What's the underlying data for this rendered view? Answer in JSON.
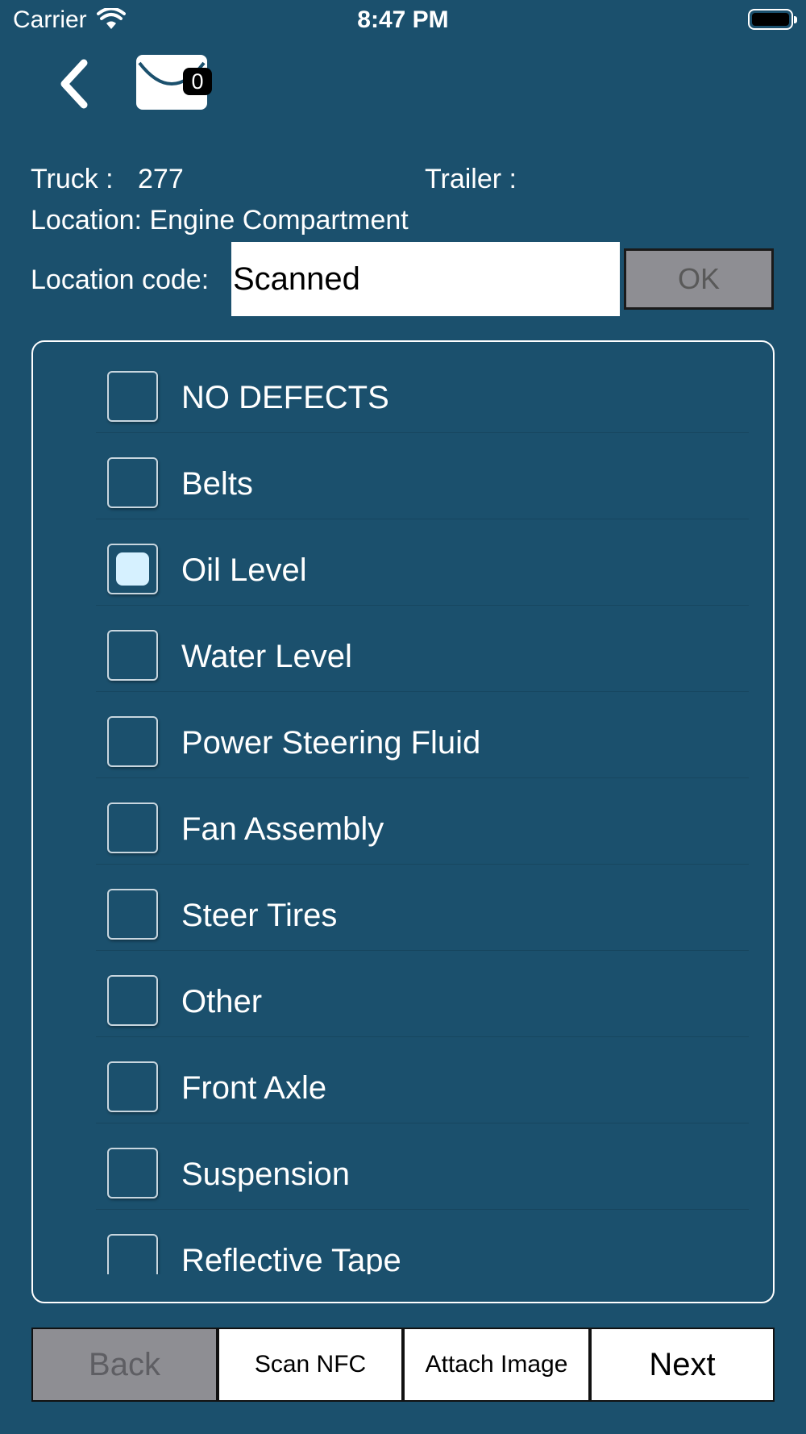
{
  "status_bar": {
    "carrier": "Carrier",
    "time": "8:47 PM"
  },
  "nav": {
    "back_icon": "chevron-left-icon",
    "mail_icon": "envelope-icon",
    "mail_badge": "0"
  },
  "info": {
    "truck_label": "Truck :",
    "truck_value": "277",
    "trailer_label": "Trailer :",
    "location_text": "Location: Engine Compartment",
    "location_code_label": "Location code:",
    "location_code_value": "Scanned",
    "ok_label": "OK"
  },
  "checklist": {
    "items": [
      {
        "label": "NO DEFECTS",
        "checked": false
      },
      {
        "label": "Belts",
        "checked": false
      },
      {
        "label": "Oil Level",
        "checked": true
      },
      {
        "label": "Water Level",
        "checked": false
      },
      {
        "label": "Power Steering Fluid",
        "checked": false
      },
      {
        "label": "Fan Assembly",
        "checked": false
      },
      {
        "label": "Steer Tires",
        "checked": false
      },
      {
        "label": "Other",
        "checked": false
      },
      {
        "label": "Front Axle",
        "checked": false
      },
      {
        "label": "Suspension",
        "checked": false
      },
      {
        "label": "Reflective Tape",
        "checked": false
      }
    ]
  },
  "toolbar": {
    "back_label": "Back",
    "scan_nfc_label": "Scan NFC",
    "attach_image_label": "Attach Image",
    "next_label": "Next"
  },
  "colors": {
    "background": "#1b506d",
    "disabled_button": "#8e8e93",
    "checked_fill": "#d6f1ff"
  }
}
